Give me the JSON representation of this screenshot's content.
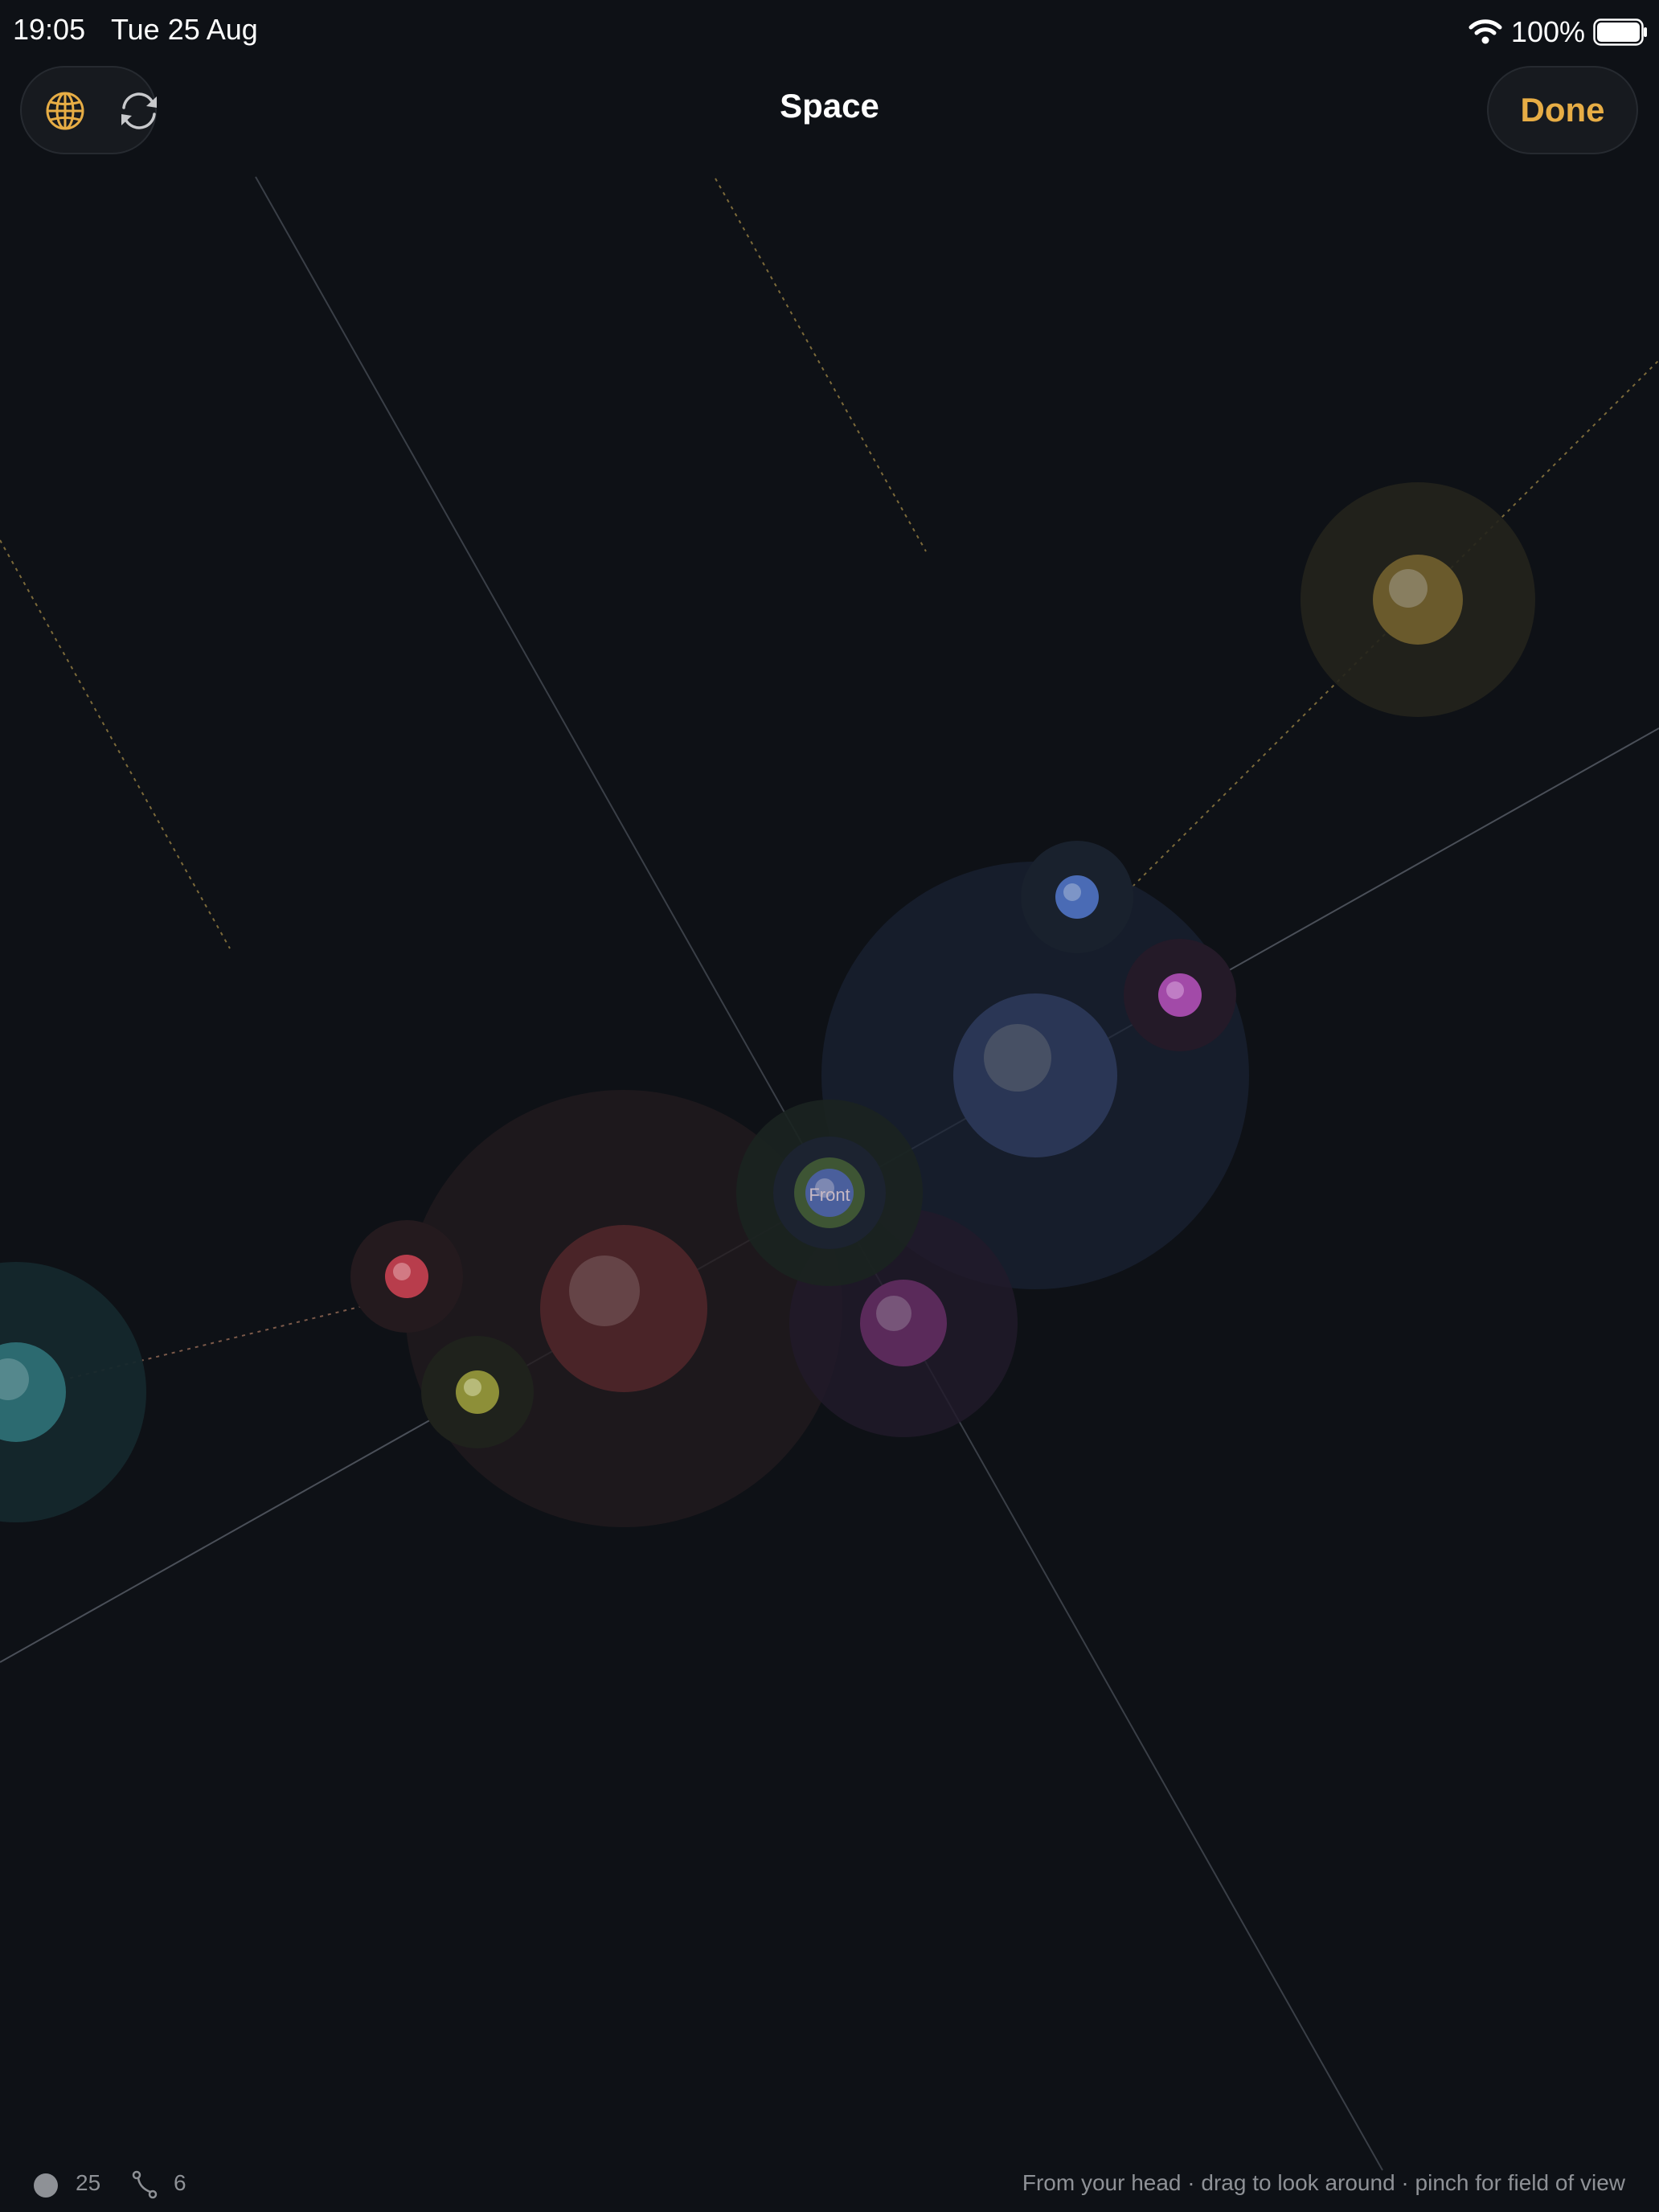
{
  "status_bar": {
    "time": "19:05",
    "date": "Tue 25 Aug",
    "battery": "100%",
    "icons": [
      "wifi-icon",
      "battery-icon"
    ]
  },
  "toolbar": {
    "title": "Space",
    "done_label": "Done",
    "left_buttons": [
      "globe-icon",
      "sync-icon"
    ]
  },
  "scene": {
    "center_label": "Front",
    "colors": {
      "background": "#0e1116",
      "accent": "#e7ad45",
      "teal": "#3fa6a6",
      "red": "#c9424f",
      "olive": "#a6a93c",
      "blue": "#4a6bb5",
      "magenta": "#b04fb8",
      "purple": "#8e3e8a",
      "gold": "#b8993f"
    }
  },
  "footer": {
    "node_count": "25",
    "link_count": "6",
    "hint": "From your head · drag to look around · pinch for field of view"
  }
}
